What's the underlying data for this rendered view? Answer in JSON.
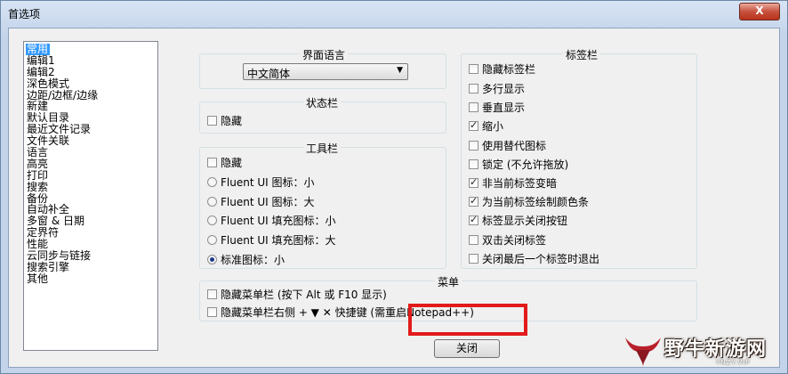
{
  "window": {
    "title": "首选项",
    "close_label": "X"
  },
  "categories": [
    "常用",
    "编辑1",
    "编辑2",
    "深色模式",
    "边距/边框/边缘",
    "新建",
    "默认目录",
    "最近文件记录",
    "文件关联",
    "语言",
    "高亮",
    "打印",
    "搜索",
    "备份",
    "自动补全",
    "多窗 & 日期",
    "定界符",
    "性能",
    "云同步与链接",
    "搜索引擎",
    "其他"
  ],
  "selected_category": "常用",
  "language": {
    "title": "界面语言",
    "selected": "中文简体"
  },
  "statusbar": {
    "title": "状态栏",
    "hide_label": "隐藏",
    "hide_checked": false
  },
  "toolbar": {
    "title": "工具栏",
    "hide_label": "隐藏",
    "hide_checked": false,
    "options": [
      {
        "label": "Fluent UI 图标：小",
        "checked": false
      },
      {
        "label": "Fluent UI 图标：大",
        "checked": false
      },
      {
        "label": "Fluent UI 填充图标：小",
        "checked": false
      },
      {
        "label": "Fluent UI 填充图标：大",
        "checked": false
      },
      {
        "label": "标准图标：小",
        "checked": true
      }
    ]
  },
  "tabbar": {
    "title": "标签栏",
    "hide_label": "隐藏标签栏",
    "hide_checked": false,
    "options": [
      {
        "label": "多行显示",
        "checked": false
      },
      {
        "label": "垂直显示",
        "checked": false
      },
      {
        "label": "缩小",
        "checked": true
      },
      {
        "label": "使用替代图标",
        "checked": false
      },
      {
        "label": "锁定 (不允许拖放)",
        "checked": false
      },
      {
        "label": "非当前标签变暗",
        "checked": true
      },
      {
        "label": "为当前标签绘制颜色条",
        "checked": true
      },
      {
        "label": "标签显示关闭按钮",
        "checked": true
      },
      {
        "label": "双击关闭标签",
        "checked": false
      },
      {
        "label": "关闭最后一个标签时退出",
        "checked": false
      }
    ]
  },
  "menu": {
    "title": "菜单",
    "options": [
      {
        "label": "隐藏菜单栏 (按下 Alt 或 F10 显示)",
        "checked": false
      },
      {
        "label": "隐藏菜单栏右侧 + ▼ ✕ 快捷键 (需重启Notepad++)",
        "checked": false
      }
    ]
  },
  "close_button_label": "关闭",
  "watermark": {
    "text": "野牛新游网",
    "sub": "YNZY.VIP"
  },
  "colors": {
    "selection": "#3399ff",
    "highlight_box": "#e21b1b"
  }
}
